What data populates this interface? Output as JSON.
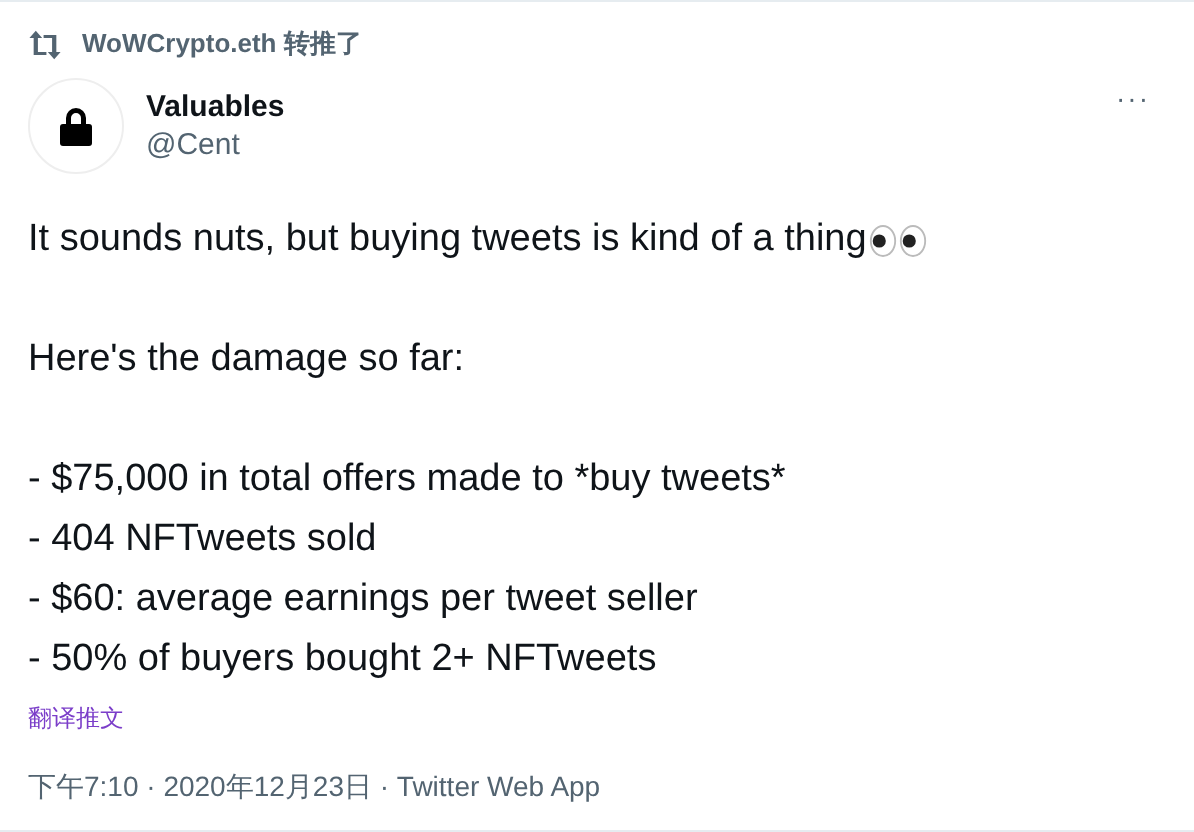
{
  "retweet": {
    "text": "WoWCrypto.eth 转推了"
  },
  "author": {
    "name": "Valuables",
    "handle": "@Cent"
  },
  "more": "···",
  "paragraphs": [
    [
      {
        "text": "It sounds nuts, but buying tweets is kind of a thing",
        "kind": "trailing_emoji"
      }
    ],
    [
      {
        "text": "Here's the damage so far:"
      }
    ],
    [
      {
        "text": "- $75,000 in total offers made to *buy tweets*"
      },
      {
        "text": "- 404 NFTweets sold"
      },
      {
        "text": "- $60: average earnings per tweet seller"
      },
      {
        "text": "- 50% of buyers bought 2+ NFTweets"
      }
    ]
  ],
  "translate": "翻译推文",
  "meta": "下午7:10 · 2020年12月23日 · Twitter Web App"
}
